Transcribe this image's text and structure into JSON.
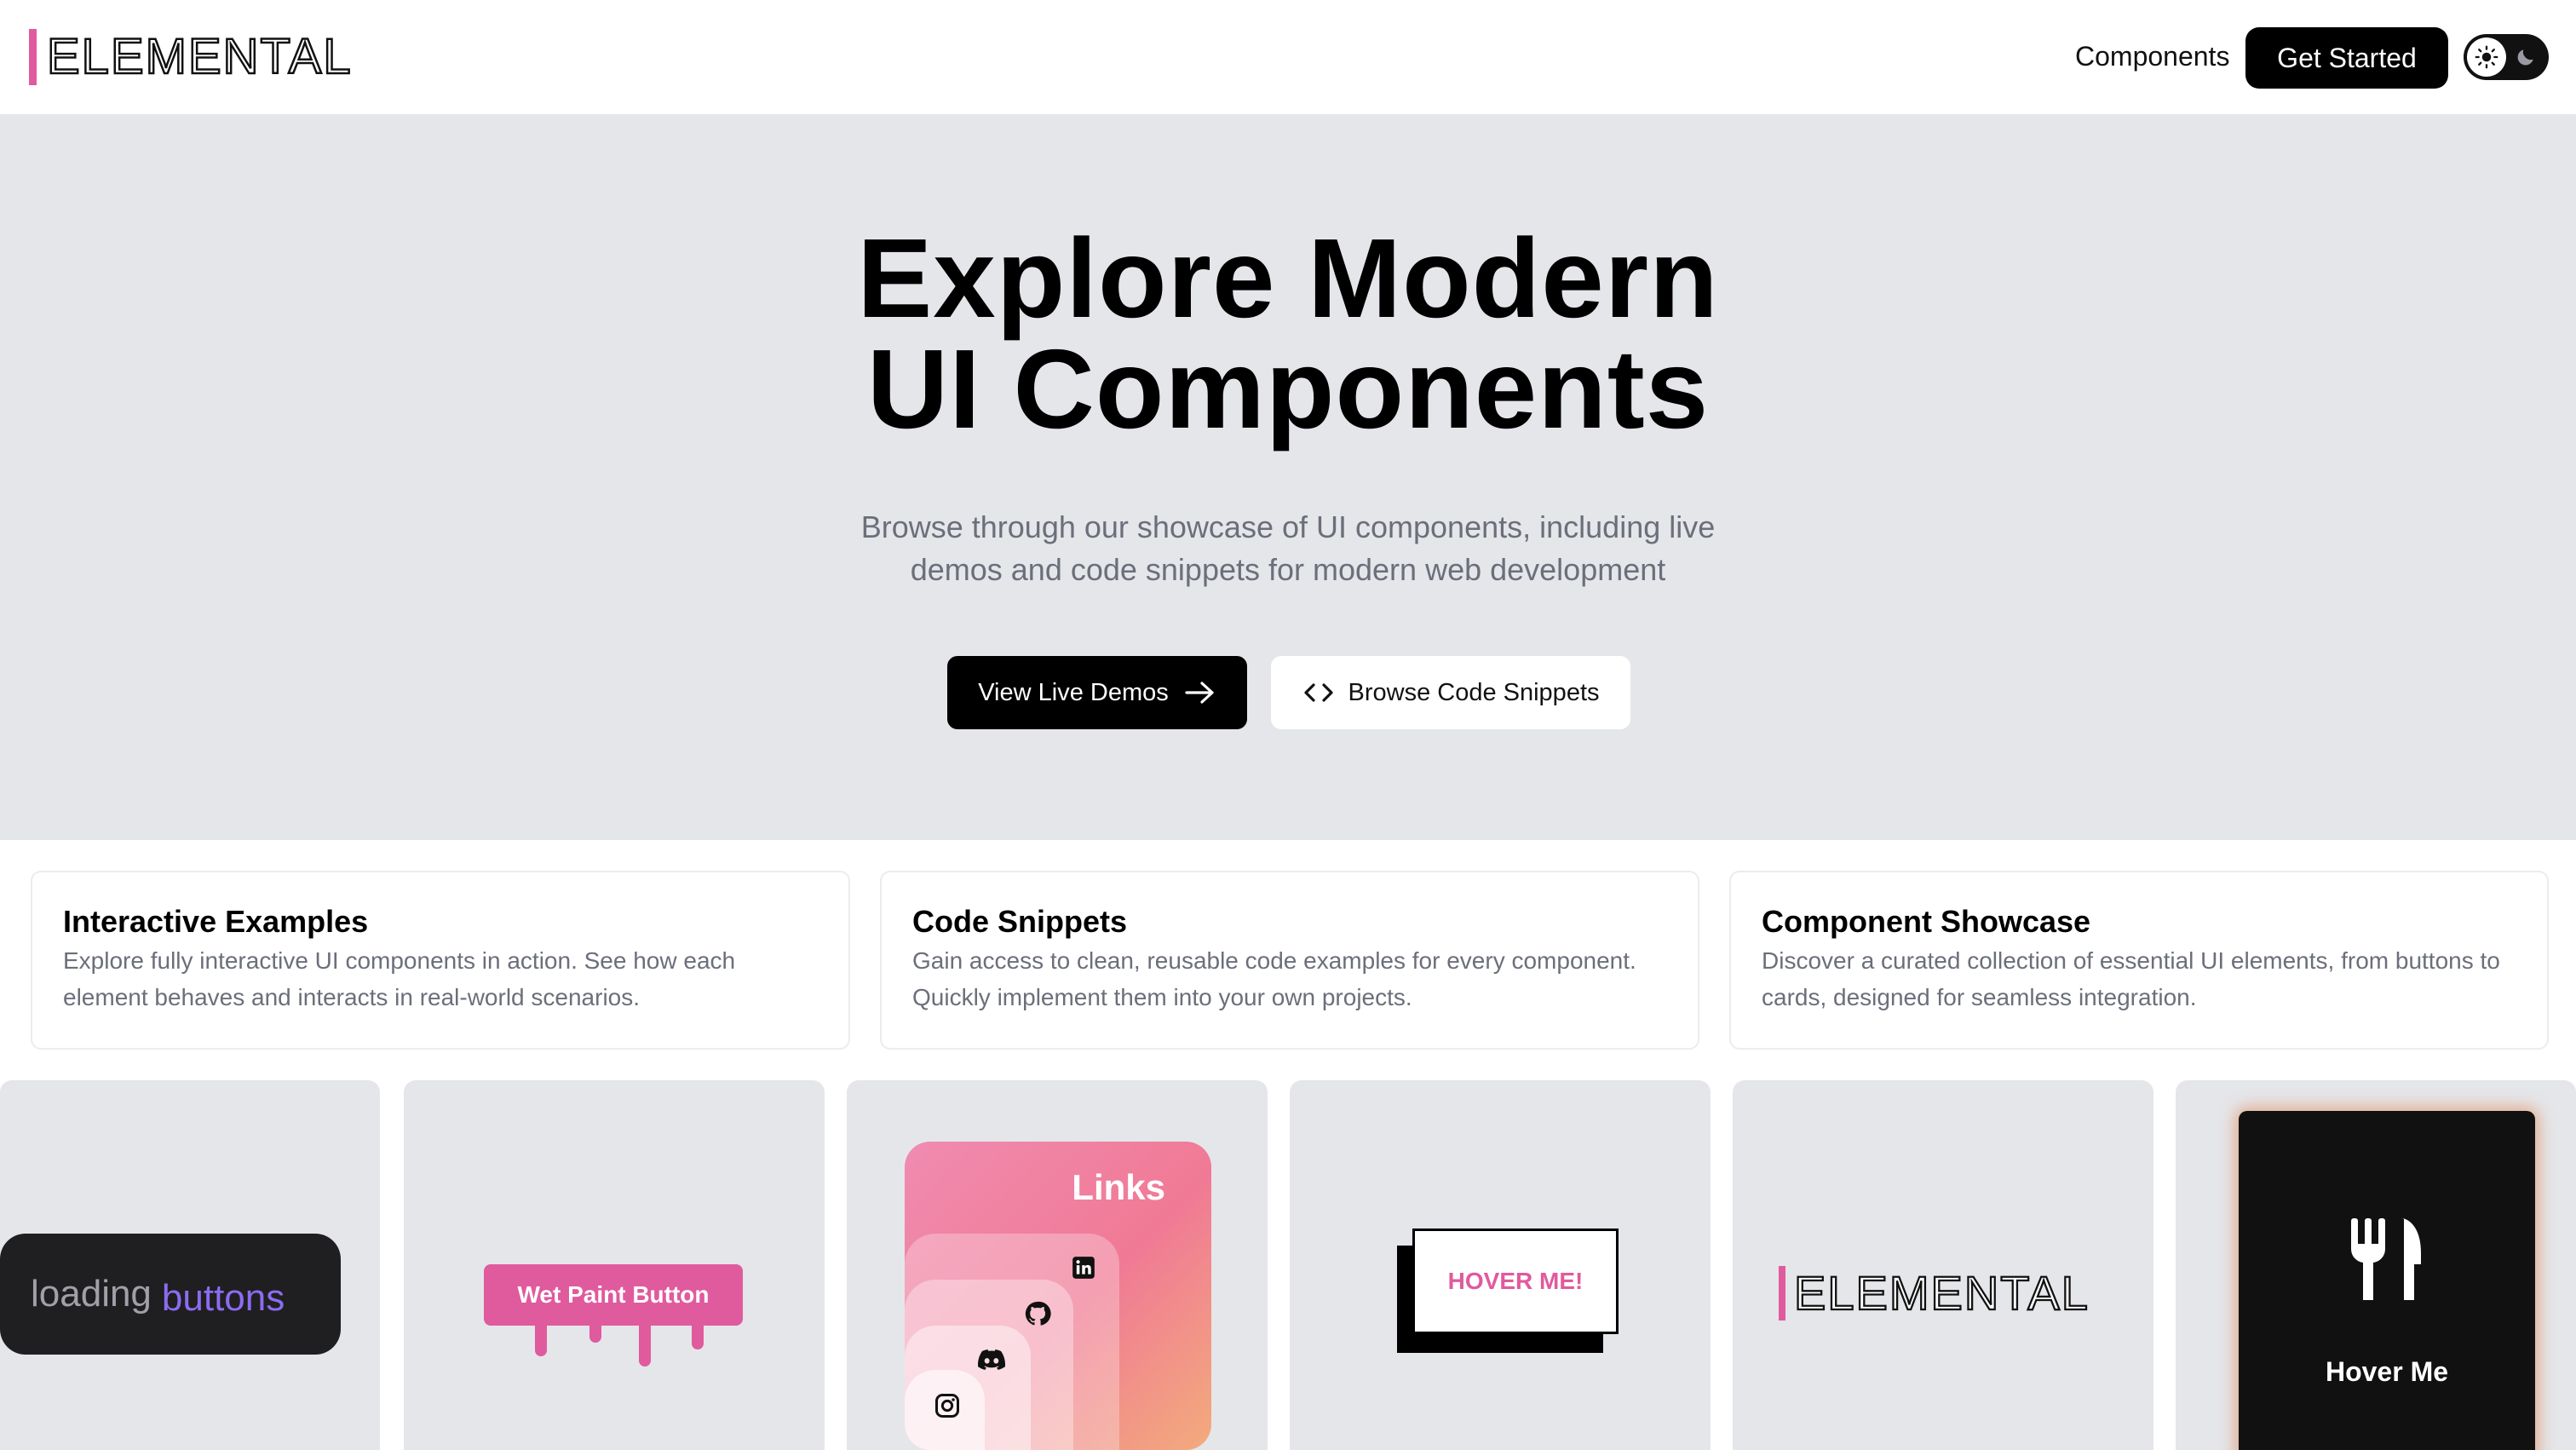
{
  "header": {
    "logo_text": "ELEMENTAL",
    "nav_components": "Components",
    "get_started": "Get Started"
  },
  "hero": {
    "title_line1": "Explore Modern",
    "title_line2": "UI Components",
    "subtitle_line1": "Browse through our showcase of UI components, including live",
    "subtitle_line2": "demos and code snippets for modern web development",
    "view_demos": "View Live Demos",
    "browse_snippets": "Browse Code Snippets"
  },
  "features": [
    {
      "title": "Interactive Examples",
      "description": "Explore fully interactive UI components in action. See how each element behaves and interacts in real-world scenarios."
    },
    {
      "title": "Code Snippets",
      "description": "Gain access to clean, reusable code examples for every component. Quickly implement them into your own projects."
    },
    {
      "title": "Component Showcase",
      "description": "Discover a curated collection of essential UI elements, from buttons to cards, designed for seamless integration."
    }
  ],
  "showcase": {
    "loading_word1": "loading",
    "loading_word2": "buttons",
    "wet_paint": "Wet Paint Button",
    "links_title": "Links",
    "link_icons": [
      "linkedin-icon",
      "github-icon",
      "discord-icon",
      "instagram-icon"
    ],
    "hover_box": "HOVER ME!",
    "logo_text": "ELEMENTAL",
    "hover_me": "Hover Me"
  },
  "colors": {
    "accent_pink": "#e05a9e",
    "hero_bg": "#e5e6ea",
    "loading_purple": "#8b6cf0"
  }
}
